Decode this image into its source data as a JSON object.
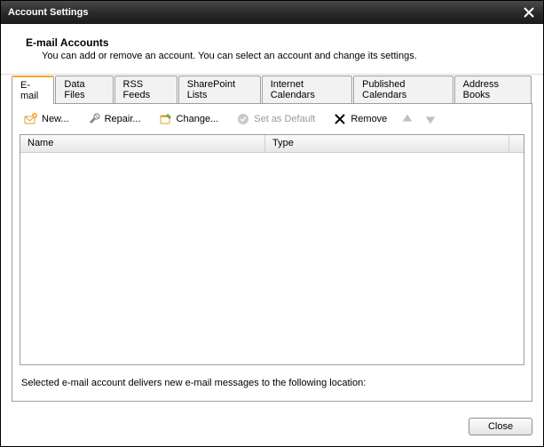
{
  "window": {
    "title": "Account Settings"
  },
  "header": {
    "title": "E-mail Accounts",
    "subtitle": "You can add or remove an account. You can select an account and change its settings."
  },
  "tabs": [
    {
      "label": "E-mail",
      "active": true
    },
    {
      "label": "Data Files",
      "active": false
    },
    {
      "label": "RSS Feeds",
      "active": false
    },
    {
      "label": "SharePoint Lists",
      "active": false
    },
    {
      "label": "Internet Calendars",
      "active": false
    },
    {
      "label": "Published Calendars",
      "active": false
    },
    {
      "label": "Address Books",
      "active": false
    }
  ],
  "toolbar": {
    "new_label": "New...",
    "repair_label": "Repair...",
    "change_label": "Change...",
    "set_default_label": "Set as Default",
    "remove_label": "Remove"
  },
  "table": {
    "columns": {
      "name": "Name",
      "type": "Type"
    },
    "rows": []
  },
  "delivery_text": "Selected e-mail account delivers new e-mail messages to the following location:",
  "footer": {
    "close_label": "Close"
  }
}
